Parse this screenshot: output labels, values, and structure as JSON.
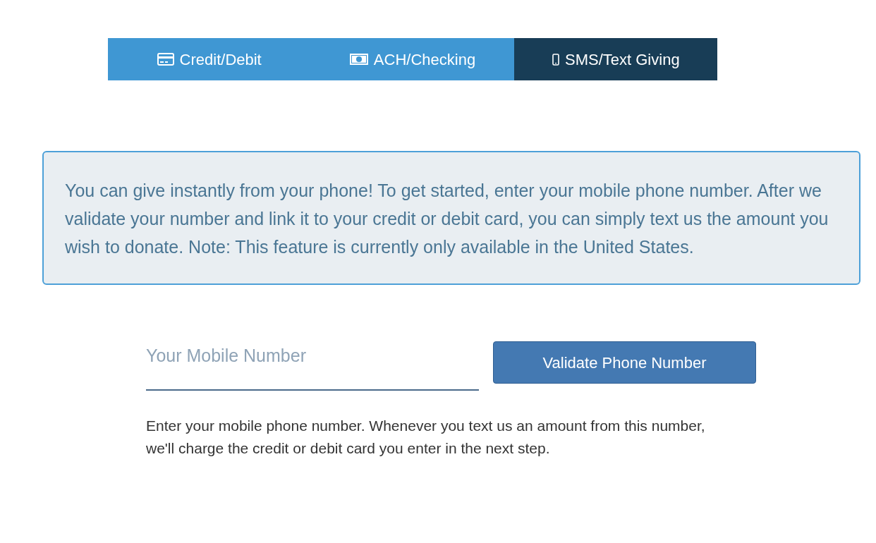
{
  "tabs": [
    {
      "label": "Credit/Debit",
      "kind": "card",
      "selected": false
    },
    {
      "label": "ACH/Checking",
      "kind": "cash",
      "selected": false
    },
    {
      "label": "SMS/Text Giving",
      "kind": "phone",
      "selected": true
    }
  ],
  "info": "You can give instantly from your phone! To get started, enter your mobile phone number. After we validate your number and link it to your credit or debit card, you can simply text us the amount you wish to donate. Note: This feature is currently only available in the United States.",
  "phone_field": {
    "placeholder": "Your Mobile Number"
  },
  "validate_button": "Validate Phone Number",
  "help": "Enter your mobile phone number. Whenever you text us an amount from this number, we'll charge the credit or debit card you enter in the next step."
}
